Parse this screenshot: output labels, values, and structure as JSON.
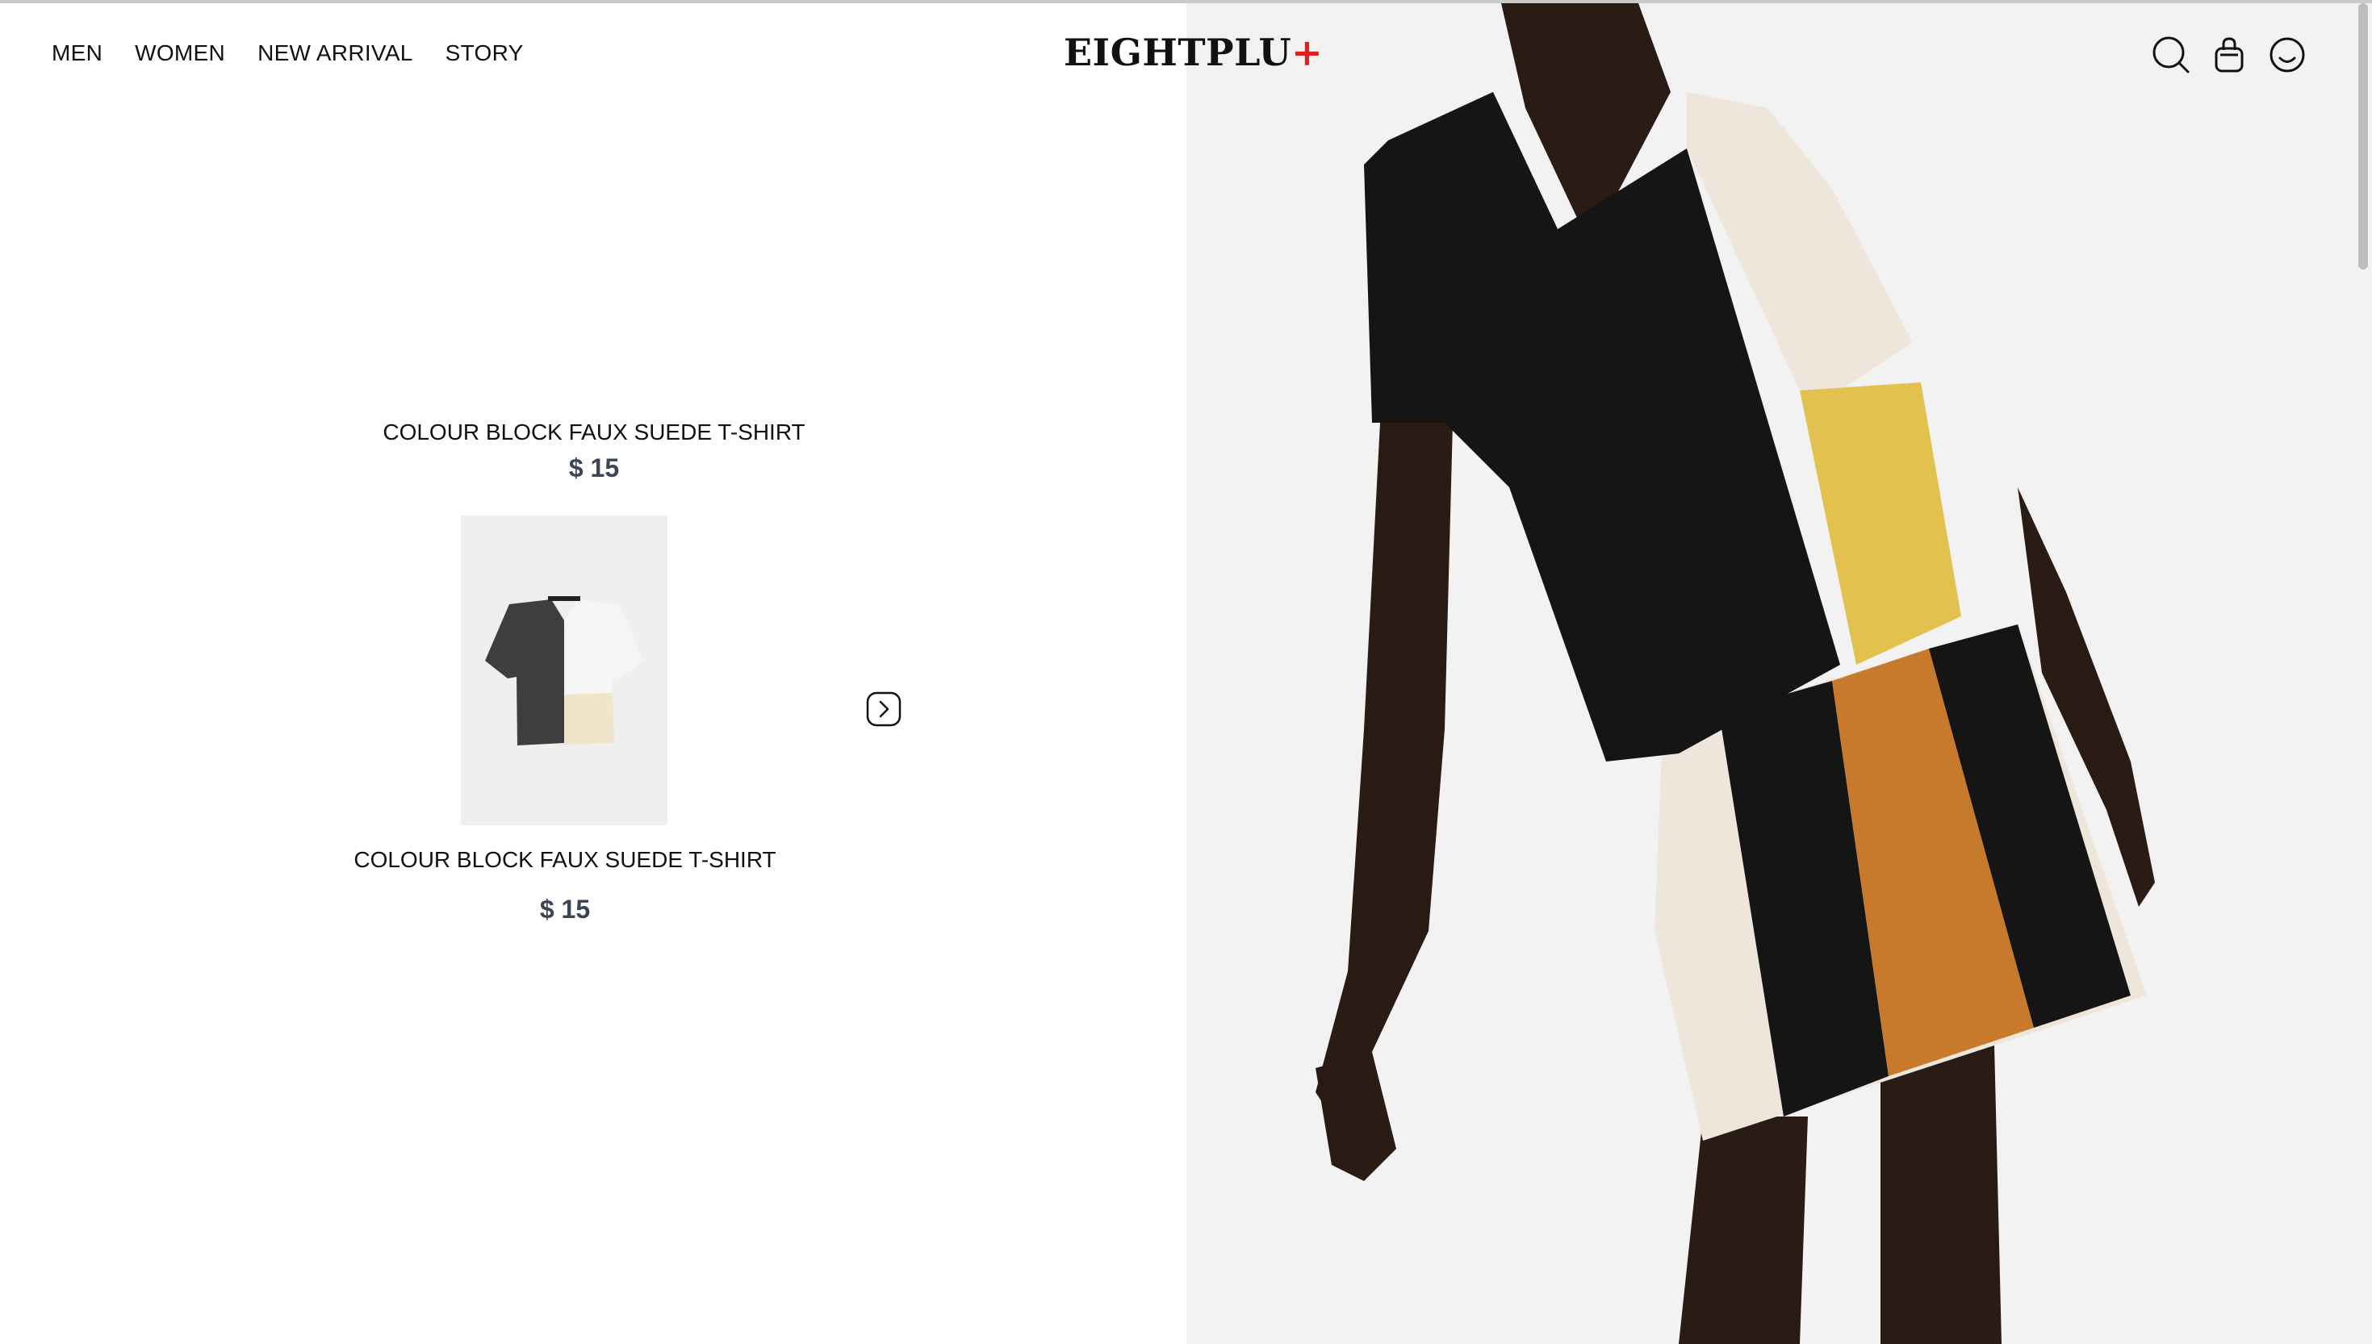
{
  "nav": {
    "items": [
      {
        "label": "MEN"
      },
      {
        "label": "WOMEN"
      },
      {
        "label": "NEW ARRIVAL"
      },
      {
        "label": "STORY"
      }
    ]
  },
  "brand": {
    "name": "EIGHTPLU",
    "plus": "+",
    "accent_color": "#e02020"
  },
  "header_icons": [
    "search-icon",
    "shopping-bag-icon",
    "account-icon"
  ],
  "products": [
    {
      "name": "COLOUR BLOCK FAUX SUEDE T-SHIRT",
      "price": "$ 15"
    },
    {
      "name": "COLOUR BLOCK FAUX SUEDE T-SHIRT",
      "price": "$ 15"
    }
  ],
  "carousel": {
    "next_icon": "chevron-right-icon"
  },
  "colors": {
    "price_text": "#3b4654",
    "hero_background": "#f2f2f2",
    "suede_black": "#151515",
    "suede_cream": "#eee6da",
    "suede_yellow": "#e3c14f",
    "suede_orange": "#c77a2c"
  }
}
